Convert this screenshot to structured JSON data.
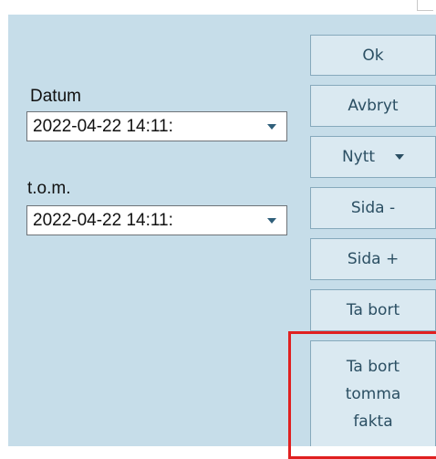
{
  "form": {
    "date_label": "Datum",
    "date_value": "2022-04-22 14:11:",
    "to_label": "t.o.m.",
    "to_value": "2022-04-22 14:11:"
  },
  "buttons": {
    "ok": "Ok",
    "cancel": "Avbryt",
    "new": "Nytt",
    "page_prev": "Sida -",
    "page_next": "Sida +",
    "delete": "Ta bort",
    "delete_empty_line1": "Ta bort",
    "delete_empty_line2": "tomma",
    "delete_empty_line3": "fakta"
  },
  "colors": {
    "panel": "#c6dde9",
    "button_face": "#dae9f1",
    "button_text": "#2b4f63",
    "highlight": "#e02020"
  },
  "icons": {
    "dropdown": "chevron-down-icon"
  }
}
